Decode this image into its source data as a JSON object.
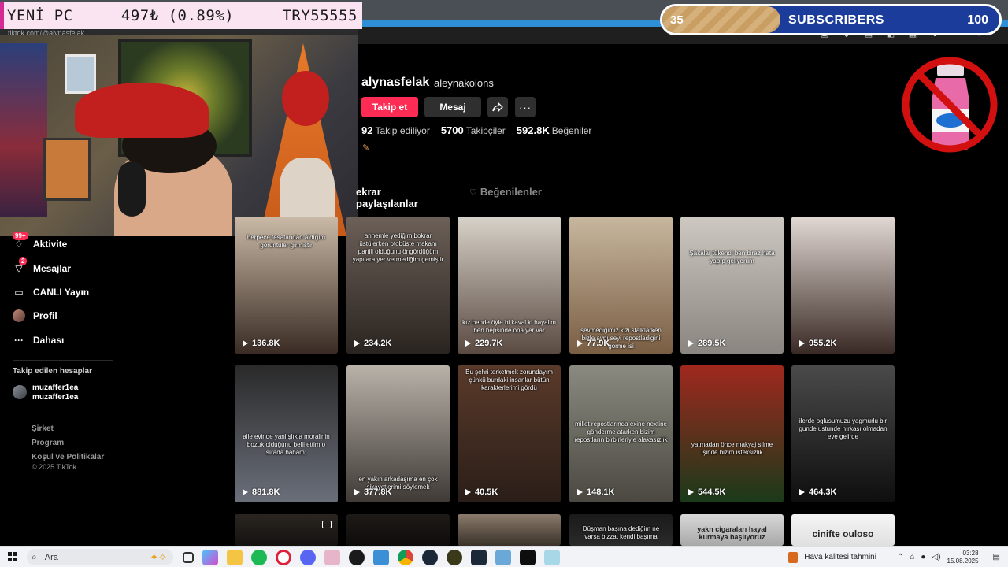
{
  "donation": {
    "name": "YENİ PC",
    "amount": "497₺ (0.89%)",
    "goal": "TRY55555"
  },
  "browser": {
    "url": "tiktok.com/@alynasfelak"
  },
  "subscribers": {
    "current": "35",
    "label": "SUBSCRIBERS",
    "goal": "100",
    "progress_fraction": 0.35
  },
  "profile": {
    "username": "alynasfelak",
    "nickname": "aleynakolons",
    "follow_label": "Takip et",
    "message_label": "Mesaj",
    "stats": [
      {
        "value": "92",
        "label": "Takip ediliyor"
      },
      {
        "value": "5700",
        "label": "Takipçiler"
      },
      {
        "value": "592.8K",
        "label": "Beğeniler"
      }
    ]
  },
  "tabs": [
    {
      "label": "ekrar paylaşılanlar"
    },
    {
      "label": "Beğenilenler"
    }
  ],
  "sidebar": {
    "items": [
      {
        "label": "Aktivite",
        "badge": "99+",
        "icon": "bell-icon"
      },
      {
        "label": "Mesajlar",
        "badge": "2",
        "icon": "message-icon"
      },
      {
        "label": "CANLI Yayın",
        "badge": "",
        "icon": "live-icon"
      },
      {
        "label": "Profil",
        "badge": "",
        "icon": "profile-icon"
      },
      {
        "label": "Dahası",
        "badge": "",
        "icon": "more-icon"
      }
    ],
    "followed_title": "Takip edilen hesaplar",
    "followed": [
      {
        "name": "muzaffer1ea",
        "handle": "muzaffer1ea"
      }
    ],
    "footer_links": [
      "Şirket",
      "Program",
      "Koşul ve Politikalar"
    ],
    "copyright": "© 2025 TikTok"
  },
  "videos": [
    {
      "views": "136.8K",
      "caption": "herpece tesatandan aldığım goruntuler girmiştir",
      "colors": [
        "#c9b9a6",
        "#3a2b24"
      ]
    },
    {
      "views": "234.2K",
      "caption": "annemle yediğim bokrar üstülerken otobüste makam partili olduğunu öngördüğüm yapılara yer vermediğim gemiştir",
      "colors": [
        "#6c6058",
        "#2a2420"
      ]
    },
    {
      "views": "229.7K",
      "caption": "kız bende öyle bi kaval ki hayalim ben hepsinde ona yer var",
      "colors": [
        "#d7d2c9",
        "#5a4a42"
      ]
    },
    {
      "views": "77.9K",
      "caption": "sevmedigimiz kizi stalklarken bizle aynı seyi repostladigini gorme isi",
      "colors": [
        "#c7b79e",
        "#7a5e44"
      ]
    },
    {
      "views": "289.5K",
      "caption": "Şakalar tükendi ben biraz hata yapıp geliyorum",
      "colors": [
        "#cdc8c1",
        "#8a8580"
      ]
    },
    {
      "views": "955.2K",
      "caption": "",
      "colors": [
        "#e2d9d4",
        "#3a2a26"
      ]
    },
    {
      "views": "881.8K",
      "caption": "aile evinde yanlışlıkla moralinin bozuk olduğunu belli ettim o sırada babam;",
      "colors": [
        "#2a2a2a",
        "#6a6f7a"
      ]
    },
    {
      "views": "377.8K",
      "caption": "en yakın arkadaşıma en çok şikayetlerimi söylemek",
      "colors": [
        "#b9b2a9",
        "#3f3a36"
      ]
    },
    {
      "views": "40.5K",
      "caption": "Bu şehri terketmek zorundayım çünkü burdaki insanlar bütün karakterlerimi gördü",
      "colors": [
        "#5a3a2a",
        "#2a1e18"
      ]
    },
    {
      "views": "148.1K",
      "caption": "millet repostlarında exine nextine gönderme atarken bizim repostların birbirleriyle alakasızlık",
      "colors": [
        "#8a8a80",
        "#4a4840"
      ]
    },
    {
      "views": "544.5K",
      "caption": "yatmadan önce makyaj silme işinde bizim isteksizlik",
      "colors": [
        "#a0281e",
        "#1a3a1a"
      ]
    },
    {
      "views": "464.3K",
      "caption": "ilerde oglusumuzu yagmurlu bir gunde ustunde hırkası olmadan eve gelirde",
      "colors": [
        "#4a4a4a",
        "#0e0e0e"
      ]
    }
  ],
  "partial_row": [
    {
      "caption": "",
      "colors": [
        "#2a2520",
        "#141210"
      ]
    },
    {
      "caption": "",
      "colors": [
        "#1e1a18",
        "#0e0c0a"
      ]
    },
    {
      "caption": "",
      "colors": [
        "#8a7a6a",
        "#3a322a"
      ]
    },
    {
      "caption": "Düşman başına dediğim ne varsa bizzat kendi başıma",
      "colors": [
        "#1a1a1a",
        "#2a2a2a"
      ]
    },
    {
      "caption": "yakn cigaraları hayal kurmaya başlıyoruz",
      "colors": [
        "#d8d8d8",
        "#a8a8a8"
      ]
    },
    {
      "caption": "cinifte ouloso",
      "colors": [
        "#f5f5f5",
        "#e0e0e0"
      ]
    }
  ],
  "taskbar": {
    "search_placeholder": "Ara",
    "weather": "Hava kalitesi tahmini",
    "time": "03:28",
    "date": "15.08.2025"
  }
}
